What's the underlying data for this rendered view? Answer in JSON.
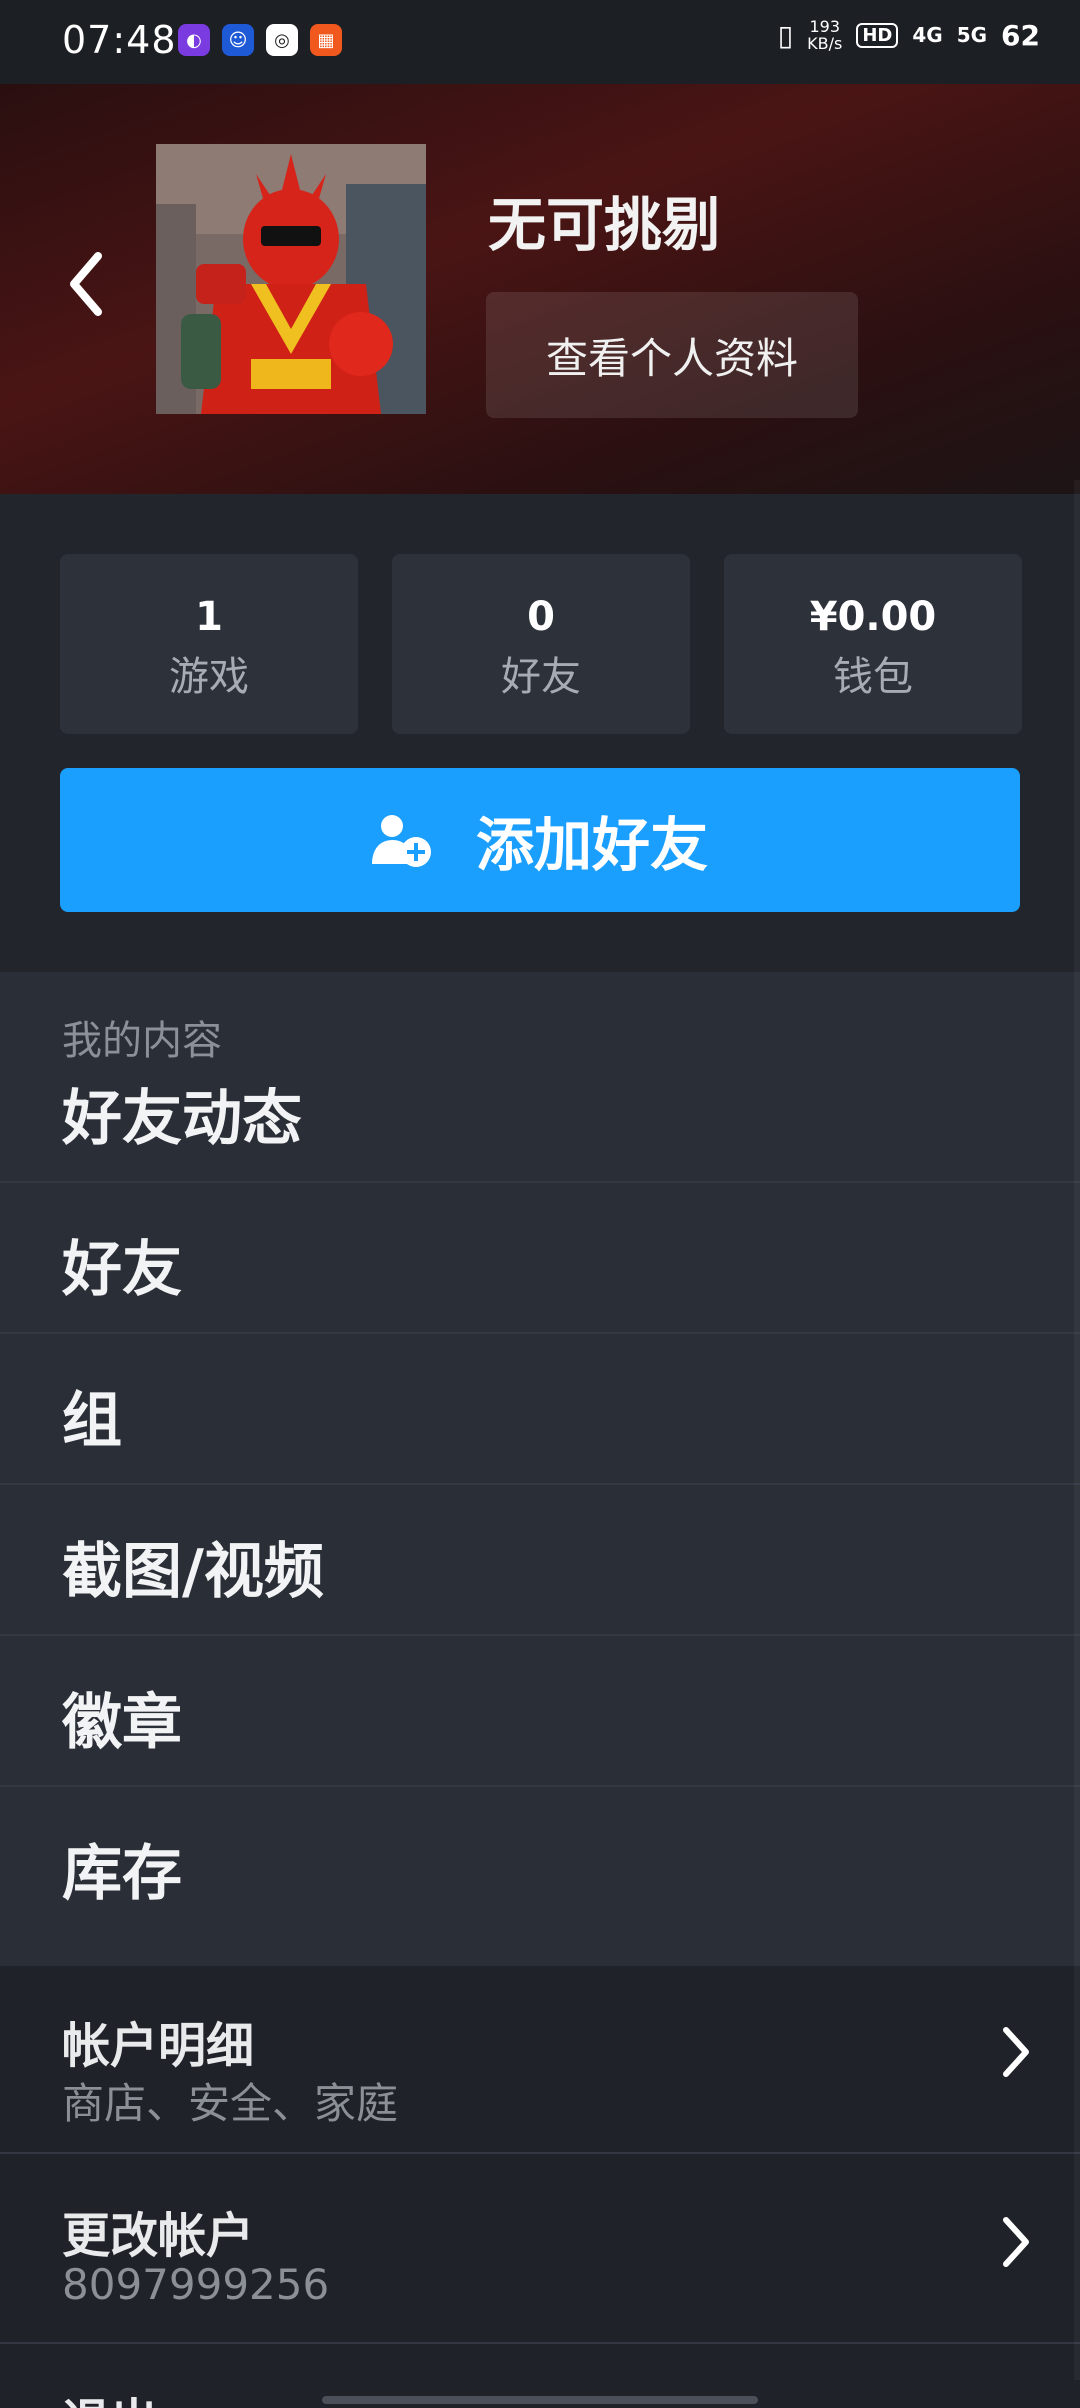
{
  "status_bar": {
    "time": "07:48",
    "net_speed": "193",
    "net_unit": "KB/s",
    "hd": "HD",
    "sig1": "4G",
    "sig2": "5G",
    "battery": "62"
  },
  "profile": {
    "name": "无可挑剔",
    "view_profile": "查看个人资料"
  },
  "stats": [
    {
      "value": "1",
      "label": "游戏"
    },
    {
      "value": "0",
      "label": "好友"
    },
    {
      "value": "¥0.00",
      "label": "钱包"
    }
  ],
  "add_friend": "添加好友",
  "my_content": {
    "heading": "我的内容",
    "items": [
      "好友动态",
      "好友",
      "组",
      "截图/视频",
      "徽章",
      "库存"
    ]
  },
  "account": {
    "details_title": "帐户明细",
    "details_sub": "商店、安全、家庭",
    "change_title": "更改帐户",
    "change_sub": "8097999256",
    "logout": "退出"
  },
  "colors": {
    "accent": "#1a9fff",
    "background": "#1b1e24"
  }
}
